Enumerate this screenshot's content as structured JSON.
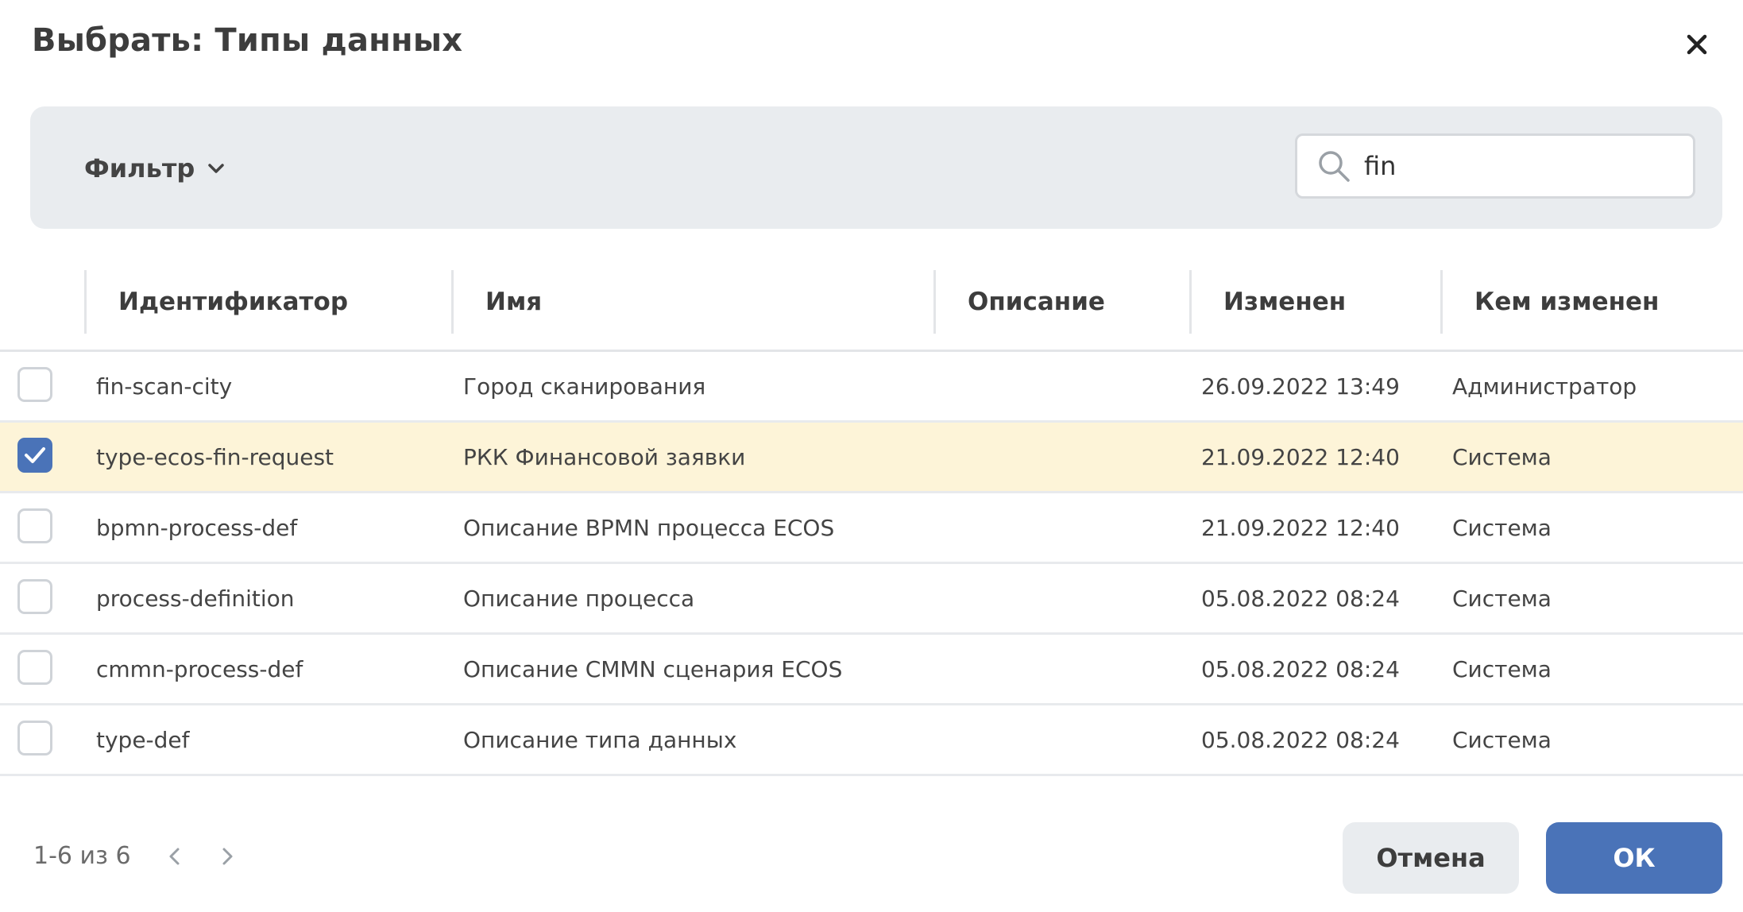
{
  "dialog": {
    "title": "Выбрать: Типы данных"
  },
  "toolbar": {
    "filter_label": "Фильтр",
    "search_value": "fin"
  },
  "table": {
    "columns": [
      "Идентификатор",
      "Имя",
      "Описание",
      "Изменен",
      "Кем изменен"
    ],
    "rows": [
      {
        "id": "fin-scan-city",
        "name": "Город сканирования",
        "description": "",
        "modified": "26.09.2022 13:49",
        "modified_by": "Администратор",
        "checked": false
      },
      {
        "id": "type-ecos-fin-request",
        "name": "РКК Финансовой заявки",
        "description": "",
        "modified": "21.09.2022 12:40",
        "modified_by": "Система",
        "checked": true
      },
      {
        "id": "bpmn-process-def",
        "name": "Описание BPMN процесса ECOS",
        "description": "",
        "modified": "21.09.2022 12:40",
        "modified_by": "Система",
        "checked": false
      },
      {
        "id": "process-definition",
        "name": "Описание процесса",
        "description": "",
        "modified": "05.08.2022 08:24",
        "modified_by": "Система",
        "checked": false
      },
      {
        "id": "cmmn-process-def",
        "name": "Описание CMMN сценария ECOS",
        "description": "",
        "modified": "05.08.2022 08:24",
        "modified_by": "Система",
        "checked": false
      },
      {
        "id": "type-def",
        "name": "Описание типа данных",
        "description": "",
        "modified": "05.08.2022 08:24",
        "modified_by": "Система",
        "checked": false
      }
    ]
  },
  "pager": {
    "range_text": "1-6 из 6"
  },
  "buttons": {
    "cancel_label": "Отмена",
    "ok_label": "ОК"
  },
  "colors": {
    "accent": "#4a73b8",
    "selected_row": "#fdf4d8",
    "toolbar_bg": "#e9ecef"
  }
}
